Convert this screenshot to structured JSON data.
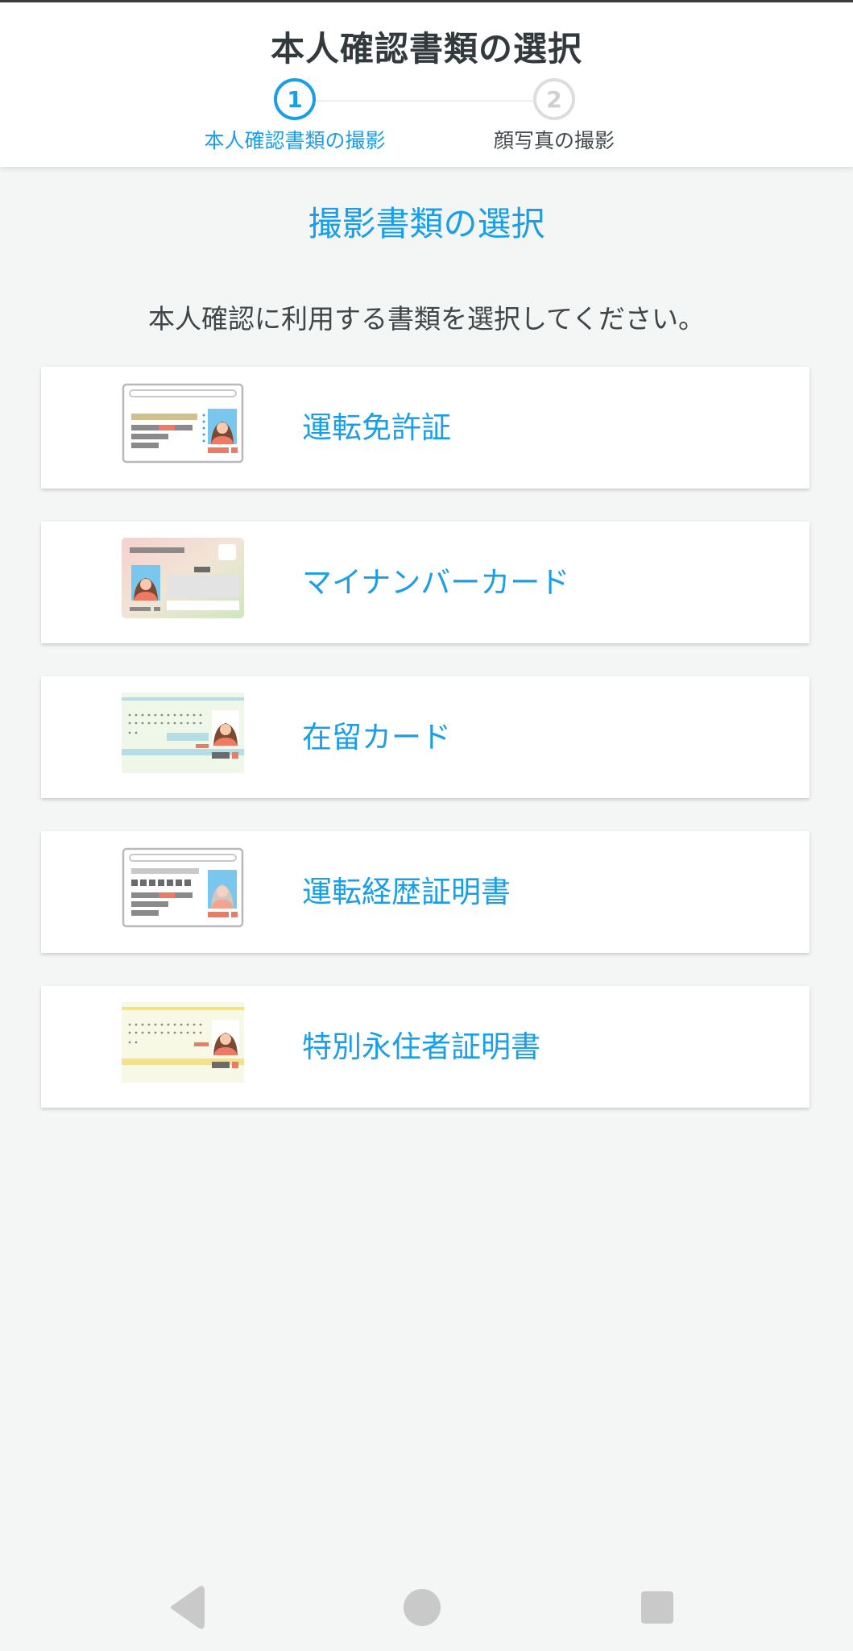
{
  "header": {
    "title": "本人確認書類の選択",
    "steps": [
      {
        "number": "1",
        "label": "本人確認書類の撮影",
        "active": true
      },
      {
        "number": "2",
        "label": "顔写真の撮影",
        "active": false
      }
    ]
  },
  "main": {
    "section_title": "撮影書類の選択",
    "instruction": "本人確認に利用する書類を選択してください。",
    "documents": [
      {
        "label": "運転免許証",
        "icon": "drivers-license-icon"
      },
      {
        "label": "マイナンバーカード",
        "icon": "my-number-card-icon"
      },
      {
        "label": "在留カード",
        "icon": "residence-card-icon"
      },
      {
        "label": "運転経歴証明書",
        "icon": "driving-history-certificate-icon"
      },
      {
        "label": "特別永住者証明書",
        "icon": "special-permanent-resident-certificate-icon"
      }
    ]
  },
  "navbar": {
    "buttons": [
      "back-icon",
      "home-icon",
      "recents-icon"
    ]
  },
  "colors": {
    "accent": "#1a9ee8",
    "background": "#f4f5f5",
    "text": "#333a3d"
  }
}
